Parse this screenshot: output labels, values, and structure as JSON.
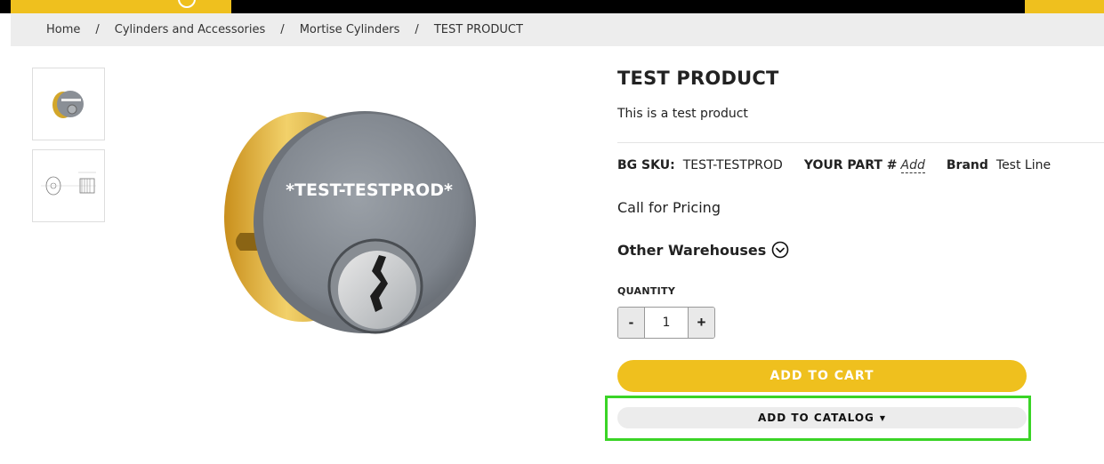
{
  "breadcrumb": {
    "items": [
      "Home",
      "Cylinders and Accessories",
      "Mortise Cylinders",
      "TEST PRODUCT"
    ],
    "separator": "/"
  },
  "product": {
    "title": "TEST PRODUCT",
    "description": "This is a test product",
    "image_text": "*TEST-TESTPROD*",
    "sku_label": "BG SKU:",
    "sku_value": "TEST-TESTPROD",
    "your_part_label": "YOUR PART #",
    "your_part_link": "Add",
    "brand_label": "Brand",
    "brand_value": "Test Line",
    "pricing": "Call for Pricing",
    "warehouses_label": "Other Warehouses"
  },
  "quantity": {
    "label": "QUANTITY",
    "value": "1",
    "minus": "-",
    "plus": "+"
  },
  "actions": {
    "add_to_cart": "ADD TO CART",
    "add_to_catalog": "ADD TO CATALOG",
    "catalog_caret": "▼"
  },
  "colors": {
    "brand_yellow": "#efc01e",
    "highlight_green": "#3ad426",
    "breadcrumb_bg": "#ededed"
  }
}
